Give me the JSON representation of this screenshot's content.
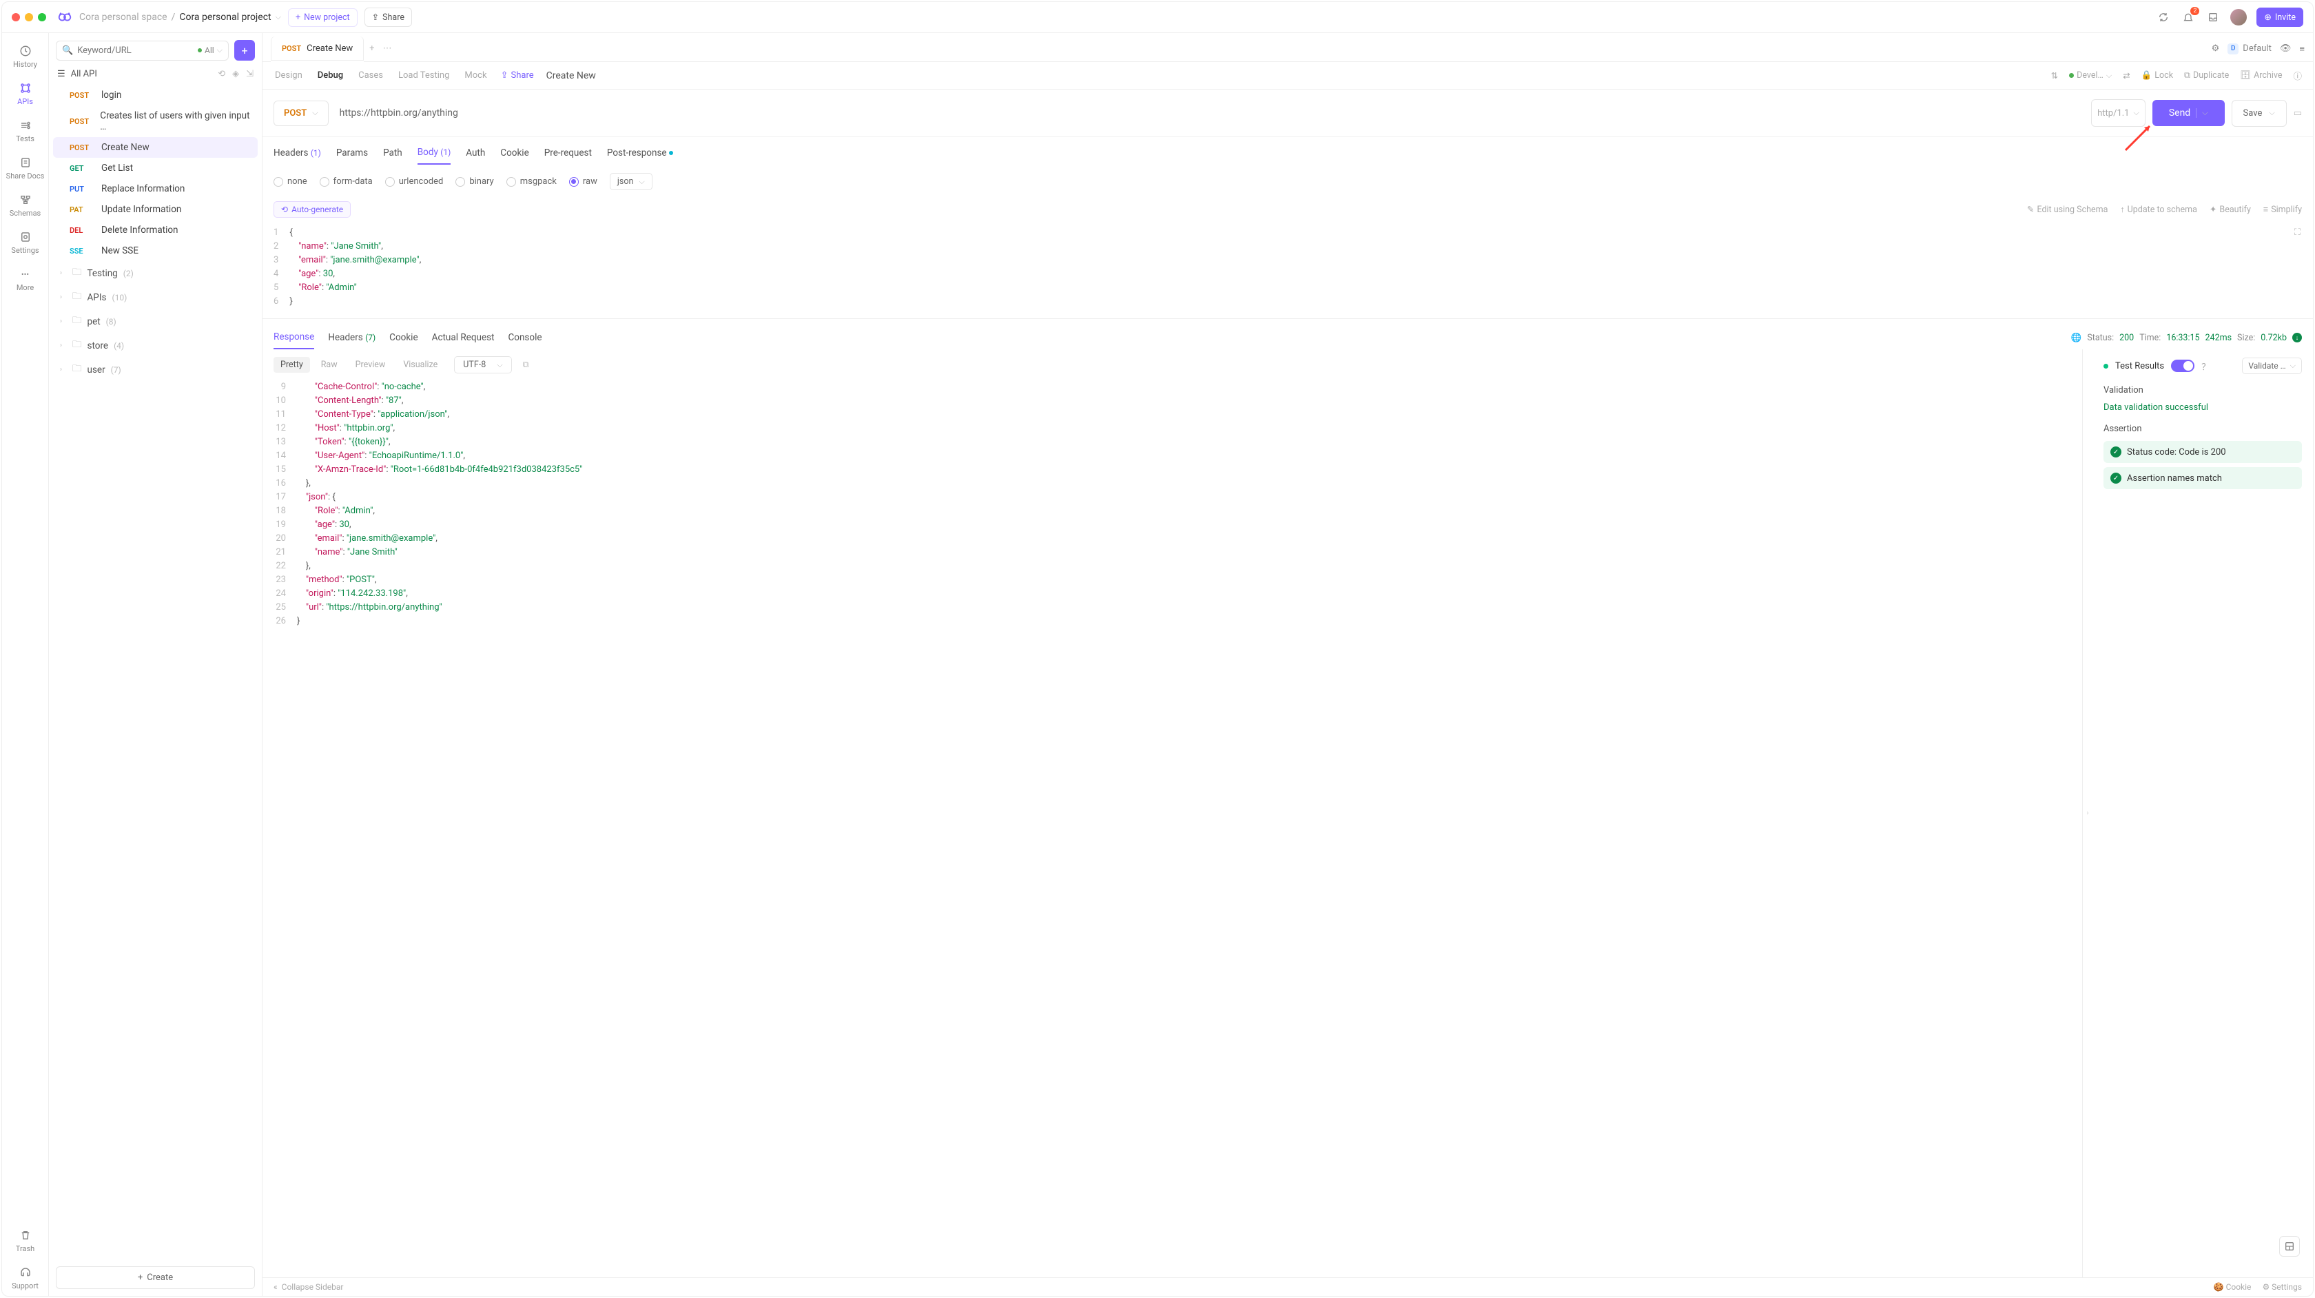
{
  "topbar": {
    "breadcrumb_space": "Cora personal space",
    "breadcrumb_project": "Cora personal project",
    "new_project": "New project",
    "share": "Share",
    "invite": "Invite",
    "environment": "Default",
    "notif_count": "2"
  },
  "rail": {
    "history": "History",
    "apis": "APIs",
    "tests": "Tests",
    "share_docs": "Share Docs",
    "schemas": "Schemas",
    "settings": "Settings",
    "more": "More",
    "trash": "Trash",
    "support": "Support"
  },
  "sidebar": {
    "search_placeholder": "Keyword/URL",
    "filter_label": "All",
    "header": "All API",
    "create": "Create",
    "items": [
      {
        "method": "POST",
        "mclass": "m-post",
        "label": "login"
      },
      {
        "method": "POST",
        "mclass": "m-post",
        "label": "Creates list of users with given input …"
      },
      {
        "method": "POST",
        "mclass": "m-post",
        "label": "Create New",
        "selected": true
      },
      {
        "method": "GET",
        "mclass": "m-get",
        "label": "Get List"
      },
      {
        "method": "PUT",
        "mclass": "m-put",
        "label": "Replace Information"
      },
      {
        "method": "PAT",
        "mclass": "m-pat",
        "label": "Update Information"
      },
      {
        "method": "DEL",
        "mclass": "m-del",
        "label": "Delete Information"
      },
      {
        "method": "SSE",
        "mclass": "m-sse",
        "label": "New SSE"
      }
    ],
    "folders": [
      {
        "name": "Testing",
        "count": "(2)"
      },
      {
        "name": "APIs",
        "count": "(10)"
      },
      {
        "name": "pet",
        "count": "(8)"
      },
      {
        "name": "store",
        "count": "(4)"
      },
      {
        "name": "user",
        "count": "(7)"
      }
    ]
  },
  "tab": {
    "method": "POST",
    "title": "Create New"
  },
  "subtabs": {
    "design": "Design",
    "debug": "Debug",
    "cases": "Cases",
    "load": "Load Testing",
    "mock": "Mock",
    "share": "Share",
    "name": "Create New",
    "env_name": "Devel…",
    "lock": "Lock",
    "duplicate": "Duplicate",
    "archive": "Archive"
  },
  "request": {
    "method": "POST",
    "url": "https://httpbin.org/anything",
    "protocol": "http/1.1",
    "send": "Send",
    "save": "Save"
  },
  "req_tabs": {
    "headers": "Headers",
    "headers_cnt": "(1)",
    "params": "Params",
    "path": "Path",
    "body": "Body",
    "body_cnt": "(1)",
    "auth": "Auth",
    "cookie": "Cookie",
    "pre": "Pre-request",
    "post": "Post-response"
  },
  "body_types": {
    "none": "none",
    "form": "form-data",
    "url": "urlencoded",
    "binary": "binary",
    "msgpack": "msgpack",
    "raw": "raw",
    "format": "json"
  },
  "editor_toolbar": {
    "auto_gen": "Auto-generate",
    "edit_schema": "Edit using Schema",
    "update_schema": "Update to schema",
    "beautify": "Beautify",
    "simplify": "Simplify"
  },
  "body_lines": [
    "1",
    "2",
    "3",
    "4",
    "5",
    "6"
  ],
  "body_json": {
    "name": "Jane Smith",
    "email": "jane.smith@example",
    "age": 30,
    "Role": "Admin"
  },
  "response": {
    "tabs": {
      "response": "Response",
      "headers": "Headers",
      "headers_cnt": "(7)",
      "cookie": "Cookie",
      "actual": "Actual Request",
      "console": "Console"
    },
    "meta": {
      "status_label": "Status:",
      "status": "200",
      "time_label": "Time:",
      "time": "16:33:15",
      "duration": "242ms",
      "size_label": "Size:",
      "size": "0.72kb"
    },
    "view_tabs": {
      "pretty": "Pretty",
      "raw": "Raw",
      "preview": "Preview",
      "visualize": "Visualize",
      "encoding": "UTF-8"
    },
    "lines": [
      "9",
      "10",
      "11",
      "12",
      "13",
      "14",
      "15",
      "16",
      "17",
      "18",
      "19",
      "20",
      "21",
      "22",
      "23",
      "24",
      "25",
      "26"
    ],
    "data": {
      "Cache-Control": "no-cache",
      "Content-Length": "87",
      "Content-Type": "application/json",
      "Host": "httpbin.org",
      "Token": "{{token}}",
      "User-Agent": "EchoapiRuntime/1.1.0",
      "X-Amzn-Trace-Id": "Root=1-66d81b4b-0f4fe4b921f3d038423f35c5",
      "json": {
        "Role": "Admin",
        "age": 30,
        "email": "jane.smith@example",
        "name": "Jane Smith"
      },
      "method": "POST",
      "origin": "114.242.33.198",
      "url": "https://httpbin.org/anything"
    }
  },
  "test_panel": {
    "title": "Test Results",
    "validate_sel": "Validate …",
    "validation_header": "Validation",
    "validation_msg": "Data validation successful",
    "assertion_header": "Assertion",
    "assertions": [
      "Status code: Code is 200",
      "Assertion names match"
    ]
  },
  "footer": {
    "collapse": "Collapse Sidebar",
    "cookie": "Cookie",
    "settings": "Settings"
  }
}
